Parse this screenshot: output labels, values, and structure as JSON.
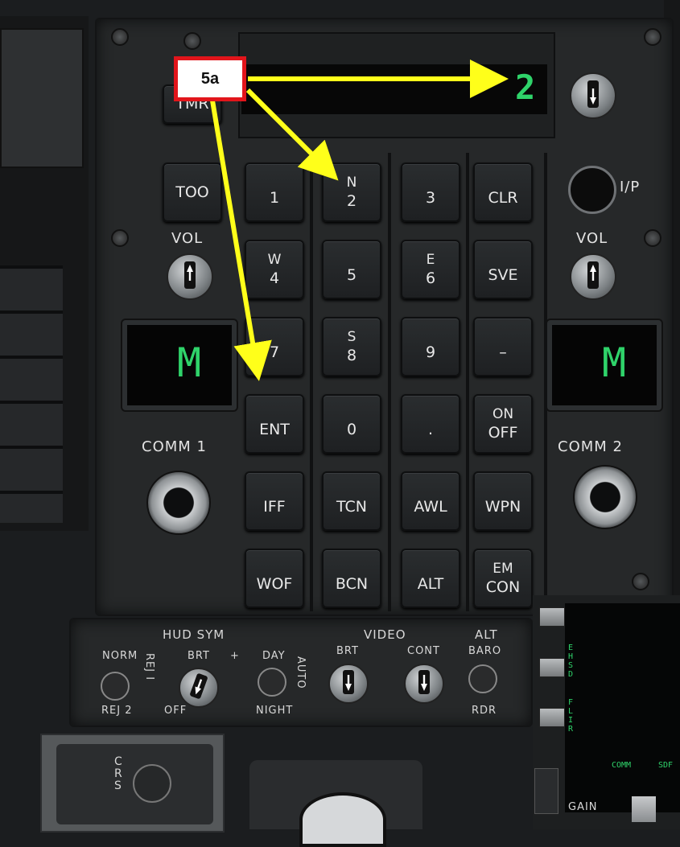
{
  "callout": {
    "label": "5a"
  },
  "scratchpad": {
    "digit": "2"
  },
  "left_panel": {
    "timer_label": "TMR",
    "too_label": "TOO",
    "vol_label": "VOL",
    "comm_label": "COMM 1",
    "display": "M"
  },
  "right_panel": {
    "ip_label": "I/P",
    "vol_label": "VOL",
    "comm_label": "COMM 2",
    "display": "M"
  },
  "keypad": {
    "keys": [
      {
        "top": "",
        "main": "1"
      },
      {
        "top": "N",
        "main": "2"
      },
      {
        "top": "",
        "main": "3"
      },
      {
        "top": "",
        "main": "CLR"
      },
      {
        "top": "W",
        "main": "4"
      },
      {
        "top": "",
        "main": "5"
      },
      {
        "top": "E",
        "main": "6"
      },
      {
        "top": "",
        "main": "SVE"
      },
      {
        "top": "",
        "main": "7"
      },
      {
        "top": "S",
        "main": "8"
      },
      {
        "top": "",
        "main": "9"
      },
      {
        "top": "",
        "main": "–"
      },
      {
        "top": "",
        "main": "ENT"
      },
      {
        "top": "",
        "main": "0"
      },
      {
        "top": "",
        "main": "."
      },
      {
        "top": "ON",
        "main": "OFF"
      },
      {
        "top": "",
        "main": "IFF"
      },
      {
        "top": "",
        "main": "TCN"
      },
      {
        "top": "",
        "main": "AWL"
      },
      {
        "top": "",
        "main": "WPN"
      },
      {
        "top": "",
        "main": "WOF"
      },
      {
        "top": "",
        "main": "BCN"
      },
      {
        "top": "",
        "main": "ALT"
      },
      {
        "top": "EM",
        "main": "CON"
      }
    ]
  },
  "lower_panel": {
    "hud_sym": "HUD SYM",
    "norm": "NORM",
    "reji": "REJ I",
    "rej2": "REJ 2",
    "brt": "BRT",
    "plus": "+",
    "off": "OFF",
    "day": "DAY",
    "night": "NIGHT",
    "auto": "AUTO",
    "video": "VIDEO",
    "video_brt": "BRT",
    "video_cont": "CONT",
    "alt": "ALT",
    "baro": "BARO",
    "rdr": "RDR"
  },
  "right_strip": {
    "ehsd": "EHSD",
    "flir": "FLIR",
    "comm": "COMM",
    "sdf": "SDF",
    "gain": "GAIN"
  },
  "bottom": {
    "crs": "CRS"
  }
}
